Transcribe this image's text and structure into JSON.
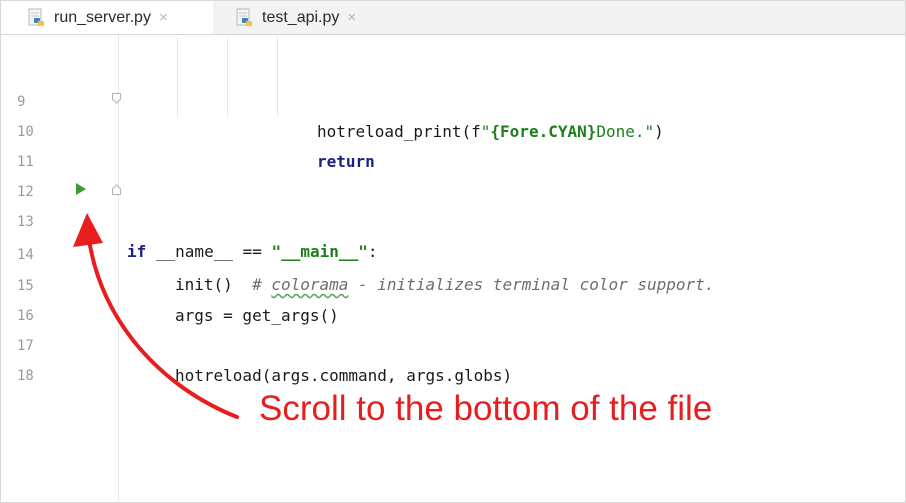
{
  "tabs": [
    {
      "label": "run_server.py",
      "active": true,
      "icon": "python-file-icon",
      "close": "×"
    },
    {
      "label": "test_api.py",
      "active": false,
      "icon": "python-file-icon",
      "close": "×"
    }
  ],
  "editor": {
    "lines": [
      {
        "number": "9"
      },
      {
        "number": "10"
      },
      {
        "number": "11"
      },
      {
        "number": "12"
      },
      {
        "number": "13"
      },
      {
        "number": "14"
      },
      {
        "number": "15"
      },
      {
        "number": "16"
      },
      {
        "number": "17"
      },
      {
        "number": "18"
      }
    ],
    "code": {
      "l9_call": "hotreload_print(f",
      "l9_str_a": "\"",
      "l9_fmt": "{Fore.CYAN}",
      "l9_str_b": "Done.\"",
      "l9_close": ")",
      "l10_kw": "return",
      "l13_kw": "if",
      "l13_name": " __name__ == ",
      "l13_str": "\"__main__\"",
      "l13_colon": ":",
      "l14_call": "init()  ",
      "l14_cmt_a": "# ",
      "l14_cmt_word": "colorama",
      "l14_cmt_b": " - initializes terminal color support.",
      "l15_code": "args = get_args()",
      "l17_code": "hotreload(args.command, args.globs)"
    }
  },
  "annotation": {
    "text": "Scroll to the bottom of the file",
    "color": "#e81e1e"
  },
  "colors": {
    "keyword": "#1a237e",
    "string": "#1b7f1b",
    "comment": "#6e6e6e",
    "run_icon": "#3a9b3a"
  }
}
